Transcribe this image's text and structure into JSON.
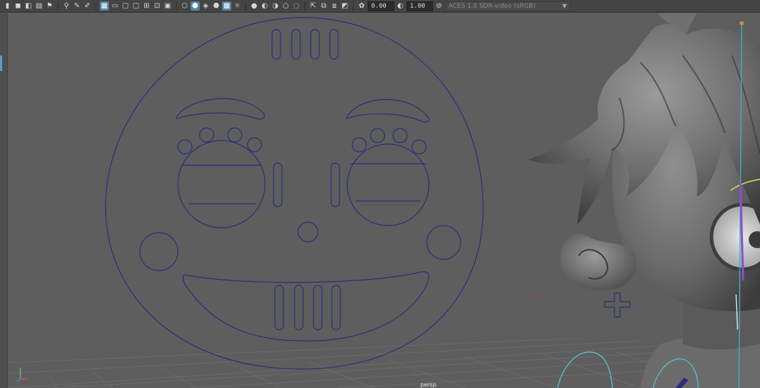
{
  "toolbar": {
    "exposure_value": "0.00",
    "gamma_value": "1.00",
    "colorspace": "ACES 1.0 SDR-video (sRGB)"
  },
  "viewport": {
    "camera_label": "persp"
  },
  "colors": {
    "viewport_bg": "#5e5e5e",
    "curve": "#2b2e7a",
    "active_blue": "#5285a6",
    "toolbar_bg": "#444444"
  }
}
